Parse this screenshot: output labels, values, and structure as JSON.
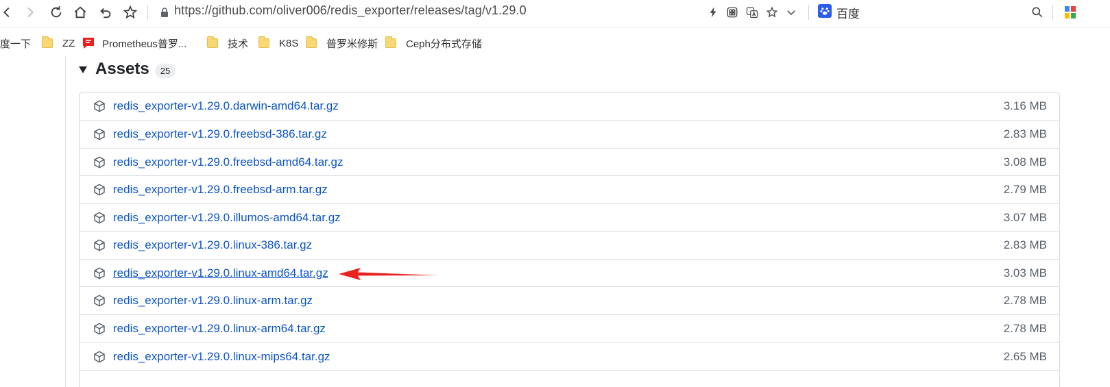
{
  "browser": {
    "url": "https://github.com/oliver006/redis_exporter/releases/tag/v1.29.0",
    "search_engine_label": "百度",
    "nav_icons": [
      "back-icon",
      "forward-icon",
      "reload-icon",
      "home-icon",
      "undo-icon",
      "star-icon"
    ],
    "right_icons": [
      "lightning-icon",
      "grid-apps-icon",
      "translate-icon",
      "star-icon",
      "chevron-down-icon"
    ]
  },
  "bookmarks": [
    {
      "label": "度一下",
      "icon": "none"
    },
    {
      "label": "ZZ",
      "icon": "folder-icon"
    },
    {
      "label": "Prometheus普罗...",
      "icon": "prometheus-icon"
    },
    {
      "label": "技术",
      "icon": "folder-icon"
    },
    {
      "label": "K8S",
      "icon": "folder-icon"
    },
    {
      "label": "普罗米修斯",
      "icon": "folder-icon"
    },
    {
      "label": "Ceph分布式存储",
      "icon": "folder-icon"
    }
  ],
  "assets": {
    "title": "Assets",
    "count": "25",
    "items": [
      {
        "name": "redis_exporter-v1.29.0.darwin-amd64.tar.gz",
        "size": "3.16 MB"
      },
      {
        "name": "redis_exporter-v1.29.0.freebsd-386.tar.gz",
        "size": "2.83 MB"
      },
      {
        "name": "redis_exporter-v1.29.0.freebsd-amd64.tar.gz",
        "size": "3.08 MB"
      },
      {
        "name": "redis_exporter-v1.29.0.freebsd-arm.tar.gz",
        "size": "2.79 MB"
      },
      {
        "name": "redis_exporter-v1.29.0.illumos-amd64.tar.gz",
        "size": "3.07 MB"
      },
      {
        "name": "redis_exporter-v1.29.0.linux-386.tar.gz",
        "size": "2.83 MB"
      },
      {
        "name": "redis_exporter-v1.29.0.linux-amd64.tar.gz",
        "size": "3.03 MB"
      },
      {
        "name": "redis_exporter-v1.29.0.linux-arm.tar.gz",
        "size": "2.78 MB"
      },
      {
        "name": "redis_exporter-v1.29.0.linux-arm64.tar.gz",
        "size": "2.78 MB"
      },
      {
        "name": "redis_exporter-v1.29.0.linux-mips64.tar.gz",
        "size": "2.65 MB"
      }
    ]
  },
  "colors": {
    "link": "#0b54c8",
    "annotation_arrow": "#e8231f",
    "baidu": "#2b5ee8",
    "folder": "#f8d775"
  }
}
